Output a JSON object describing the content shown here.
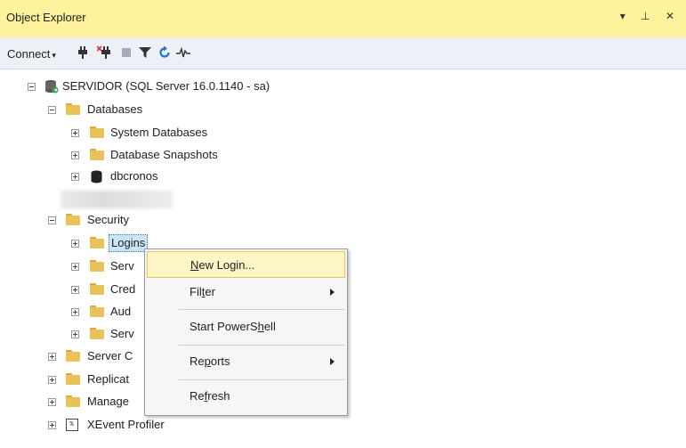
{
  "panel": {
    "title": "Object Explorer",
    "controls": "▾ ⊥ ✕"
  },
  "toolbar": {
    "connect_label": "Connect",
    "caret": "▾"
  },
  "tree": {
    "server": "SERVIDOR (SQL Server 16.0.1140 - sa)",
    "databases": "Databases",
    "system_databases": "System Databases",
    "database_snapshots": "Database Snapshots",
    "dbcronos": "dbcronos",
    "security": "Security",
    "logins": "Logins",
    "serv1": "Serv",
    "cred": "Cred",
    "aud": "Aud",
    "serv2": "Serv",
    "server_objects": "Server C",
    "replication": "Replicat",
    "management": "Manage",
    "xevent": "XEvent Profiler"
  },
  "context_menu": {
    "new_login": {
      "pre": "",
      "u": "N",
      "post": "ew Login..."
    },
    "filter": {
      "pre": "Fil",
      "u": "t",
      "post": "er"
    },
    "powershell": {
      "pre": "Start PowerS",
      "u": "h",
      "post": "ell"
    },
    "reports": {
      "pre": "Re",
      "u": "p",
      "post": "orts"
    },
    "refresh": {
      "pre": "Re",
      "u": "f",
      "post": "resh"
    }
  }
}
